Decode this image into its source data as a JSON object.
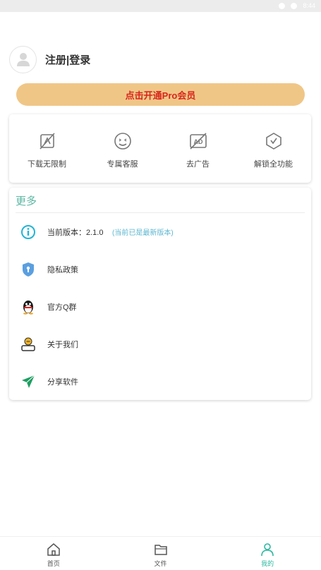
{
  "status_bar": {
    "time": "8:44"
  },
  "profile": {
    "login_text": "注册|登录"
  },
  "pro_button": {
    "label": "点击开通Pro会员"
  },
  "perks": [
    {
      "label": "下载无限制",
      "icon": "unlimited-download-icon"
    },
    {
      "label": "专属客服",
      "icon": "smiley-service-icon"
    },
    {
      "label": "去广告",
      "icon": "no-ads-icon"
    },
    {
      "label": "解锁全功能",
      "icon": "unlock-shield-icon"
    }
  ],
  "more": {
    "title": "更多",
    "items": [
      {
        "label": "当前版本：2.1.0",
        "note": "(当前已是最新版本)",
        "icon": "info-icon"
      },
      {
        "label": "隐私政策",
        "icon": "privacy-shield-icon"
      },
      {
        "label": "官方Q群",
        "icon": "qq-penguin-icon"
      },
      {
        "label": "关于我们",
        "icon": "about-coin-icon"
      },
      {
        "label": "分享软件",
        "icon": "share-arrow-icon"
      }
    ]
  },
  "tabs": [
    {
      "label": "首页",
      "icon": "home-icon"
    },
    {
      "label": "文件",
      "icon": "folder-icon"
    },
    {
      "label": "我的",
      "icon": "person-icon",
      "active": true
    }
  ],
  "colors": {
    "accent": "#2db8a0",
    "pro_button_bg": "#f0c687",
    "pro_button_text": "#d8261c",
    "more_title": "#5bb7a2",
    "version_note": "#5bb7d0"
  }
}
